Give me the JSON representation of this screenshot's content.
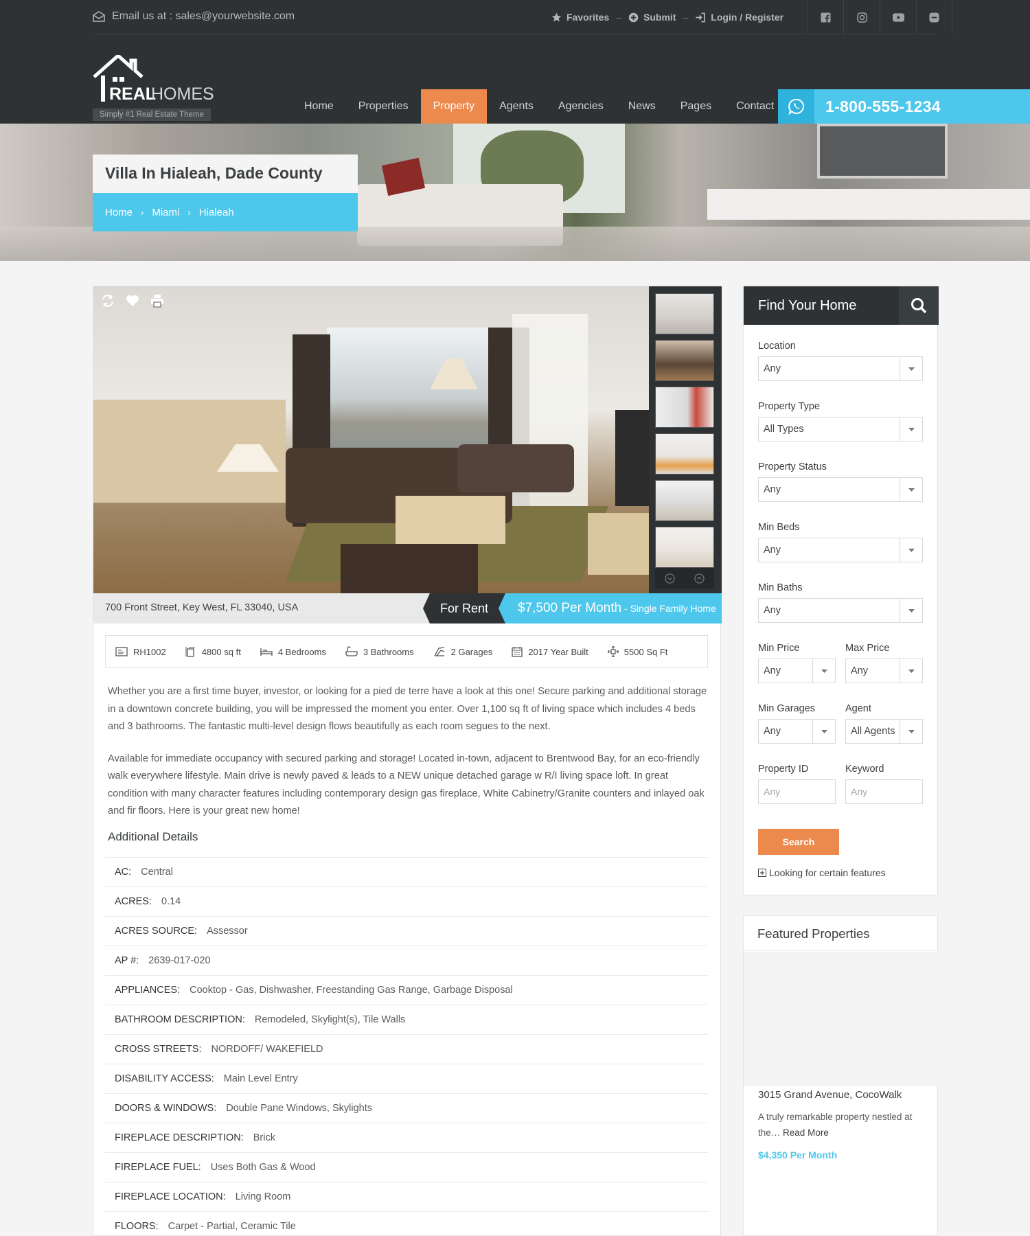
{
  "topbar": {
    "email": "Email us at : sales@yourwebsite.com",
    "links": [
      "Favorites",
      "Submit",
      "Login / Register"
    ],
    "separator": "–",
    "social_icons": [
      "facebook-icon",
      "instagram-icon",
      "youtube-icon",
      "skype-icon"
    ]
  },
  "logo": {
    "brand_bold": "REAL",
    "brand_light": "HOMES",
    "tagline": "Simply #1 Real Estate Theme"
  },
  "nav": {
    "items": [
      "Home",
      "Properties",
      "Property",
      "Agents",
      "Agencies",
      "News",
      "Pages",
      "Contact"
    ],
    "active": "Property"
  },
  "phone": {
    "number": "1-800-555-1234",
    "icon": "whatsapp-icon"
  },
  "page": {
    "title": "Villa In Hialeah, Dade County",
    "breadcrumbs": [
      "Home",
      "Miami",
      "Hialeah"
    ]
  },
  "property": {
    "address": "700 Front Street, Key West, FL 33040, USA",
    "status": "For Rent",
    "price": "$7,500 Per Month",
    "type": "- Single Family Home",
    "meta": [
      {
        "icon": "id-card-icon",
        "text": "RH1002"
      },
      {
        "icon": "area-icon",
        "text": "4800 sq ft"
      },
      {
        "icon": "bed-icon",
        "text": "4 Bedrooms"
      },
      {
        "icon": "bath-icon",
        "text": "3 Bathrooms"
      },
      {
        "icon": "garage-icon",
        "text": "2 Garages"
      },
      {
        "icon": "calendar-icon",
        "text": "2017 Year Built"
      },
      {
        "icon": "size-icon",
        "text": "5500 Sq Ft"
      }
    ],
    "description": [
      "Whether you are a first time buyer, investor, or looking for a pied de terre have a look at this one! Secure parking and additional storage in a downtown concrete building, you will be impressed the moment you enter. Over 1,100 sq ft of living space which includes 4 beds and 3 bathrooms. The fantastic multi-level design flows beautifully as each room segues to the next.",
      "Available for immediate occupancy with secured parking and storage! Located in-town, adjacent to Brentwood Bay, for an eco-friendly walk everywhere lifestyle. Main drive is newly paved & leads to a NEW unique detached garage w R/I living space loft. In great condition with many character features including contemporary design gas fireplace, White Cabinetry/Granite counters and inlayed oak and fir floors. Here is your great new home!"
    ],
    "additional_title": "Additional Details",
    "details": [
      {
        "k": "AC:",
        "v": "Central"
      },
      {
        "k": "ACRES:",
        "v": "0.14"
      },
      {
        "k": "ACRES SOURCE:",
        "v": "Assessor"
      },
      {
        "k": "AP #:",
        "v": "2639-017-020"
      },
      {
        "k": "APPLIANCES:",
        "v": "Cooktop - Gas, Dishwasher, Freestanding Gas Range, Garbage Disposal"
      },
      {
        "k": "BATHROOM DESCRIPTION:",
        "v": "Remodeled, Skylight(s), Tile Walls"
      },
      {
        "k": "CROSS STREETS:",
        "v": "NORDOFF/ WAKEFIELD"
      },
      {
        "k": "DISABILITY ACCESS:",
        "v": "Main Level Entry"
      },
      {
        "k": "DOORS & WINDOWS:",
        "v": "Double Pane Windows, Skylights"
      },
      {
        "k": "FIREPLACE DESCRIPTION:",
        "v": "Brick"
      },
      {
        "k": "FIREPLACE FUEL:",
        "v": "Uses Both Gas & Wood"
      },
      {
        "k": "FIREPLACE LOCATION:",
        "v": "Living Room"
      },
      {
        "k": "FLOORS:",
        "v": "Carpet - Partial, Ceramic Tile"
      }
    ]
  },
  "search": {
    "title": "Find Your Home",
    "location": {
      "label": "Location",
      "value": "Any"
    },
    "property_type": {
      "label": "Property Type",
      "value": "All Types"
    },
    "property_status": {
      "label": "Property Status",
      "value": "Any"
    },
    "min_beds": {
      "label": "Min Beds",
      "value": "Any"
    },
    "min_baths": {
      "label": "Min Baths",
      "value": "Any"
    },
    "min_price": {
      "label": "Min Price",
      "value": "Any"
    },
    "max_price": {
      "label": "Max Price",
      "value": "Any"
    },
    "min_garages": {
      "label": "Min Garages",
      "value": "Any"
    },
    "agent": {
      "label": "Agent",
      "value": "All Agents"
    },
    "property_id": {
      "label": "Property ID",
      "placeholder": "Any"
    },
    "keyword": {
      "label": "Keyword",
      "placeholder": "Any"
    },
    "button": "Search",
    "features_link": "Looking for certain features"
  },
  "featured": {
    "title": "Featured Properties",
    "item_title": "3015 Grand Avenue, CocoWalk",
    "item_desc": "A truly remarkable property nestled at the…",
    "read_more": "Read More",
    "item_price": "$4,350 Per Month"
  },
  "colors": {
    "dark": "#2e3234",
    "accent_orange": "#ec894d",
    "accent_blue": "#4dc7ec"
  }
}
